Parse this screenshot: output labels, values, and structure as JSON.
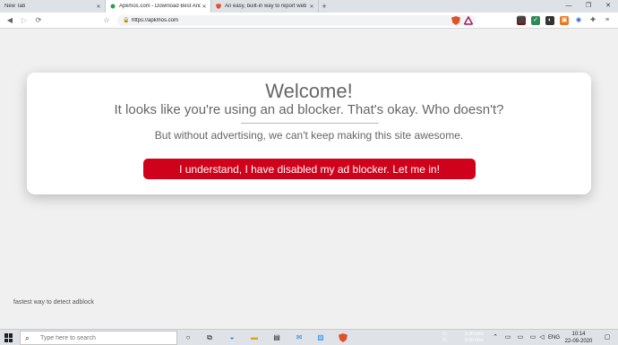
{
  "browser": {
    "tabs": [
      {
        "title": "New Tab",
        "active": false
      },
      {
        "title": "Apkmos.com - Download Best Andr",
        "active": true
      },
      {
        "title": "An easy, built-in way to report web",
        "active": false
      }
    ],
    "new_tab": "+",
    "address": "https://apkmos.com",
    "window_controls": {
      "minimize": "—",
      "maximize": "❐",
      "close": "✕"
    }
  },
  "page": {
    "heading": "Welcome!",
    "subtitle": "It looks like you're using an ad blocker. That's okay. Who doesn't?",
    "message": "But without advertising, we can't keep making this site awesome.",
    "cta_label": "I understand, I have disabled my ad blocker. Let me in!",
    "footnote": "fastest way to detect adblock"
  },
  "taskbar": {
    "search_placeholder": "Type here to search",
    "network": {
      "up_label": "U:",
      "down_label": "D:",
      "up_rate": "0.00 kB/s",
      "down_rate": "0.00 kB/s"
    },
    "language": "ENG",
    "time": "10:14",
    "date": "22-09-2020"
  },
  "colors": {
    "accent": "#d0021b",
    "card_bg": "#ffffff",
    "page_bg": "#f0f0f0"
  }
}
